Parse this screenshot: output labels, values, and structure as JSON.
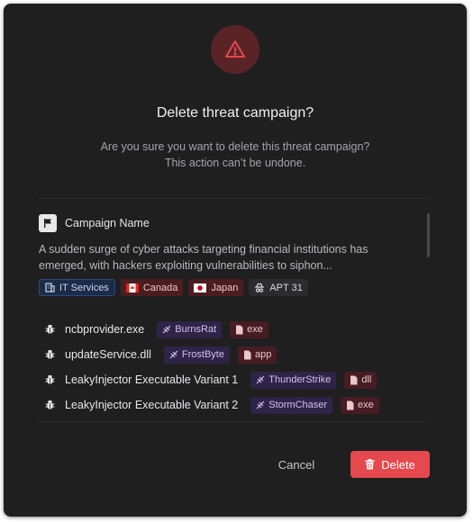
{
  "dialog": {
    "title": "Delete threat campaign?",
    "subtitle_line1": "Are you sure you want to delete this threat campaign?",
    "subtitle_line2": "This action can’t be undone."
  },
  "campaign": {
    "label": "Campaign Name",
    "description_line1": "A sudden surge of cyber attacks targeting financial institutions has",
    "description_line2": "emerged, with hackers exploiting vulnerabilities to siphon...",
    "tags": [
      {
        "label": "IT Services",
        "icon": "building-icon",
        "style": "blue"
      },
      {
        "label": "Canada",
        "icon": "canada-flag-icon",
        "style": "red"
      },
      {
        "label": "Japan",
        "icon": "japan-flag-icon",
        "style": "red"
      },
      {
        "label": "APT 31",
        "icon": "spy-icon",
        "style": "gray"
      }
    ]
  },
  "files": [
    {
      "name": "ncbprovider.exe",
      "malware": "BurnsRat",
      "ext": "exe"
    },
    {
      "name": "updateService.dll",
      "malware": "FrostByte",
      "ext": "app"
    },
    {
      "name": "LeakyInjector Executable Variant 1",
      "malware": "ThunderStrike",
      "ext": "dll"
    },
    {
      "name": "LeakyInjector Executable Variant 2",
      "malware": "StormChaser",
      "ext": "exe"
    }
  ],
  "buttons": {
    "cancel": "Cancel",
    "delete": "Delete"
  },
  "colors": {
    "background": "#1f1f20",
    "danger": "#e5484d",
    "warning_circle": "#5a2426"
  }
}
